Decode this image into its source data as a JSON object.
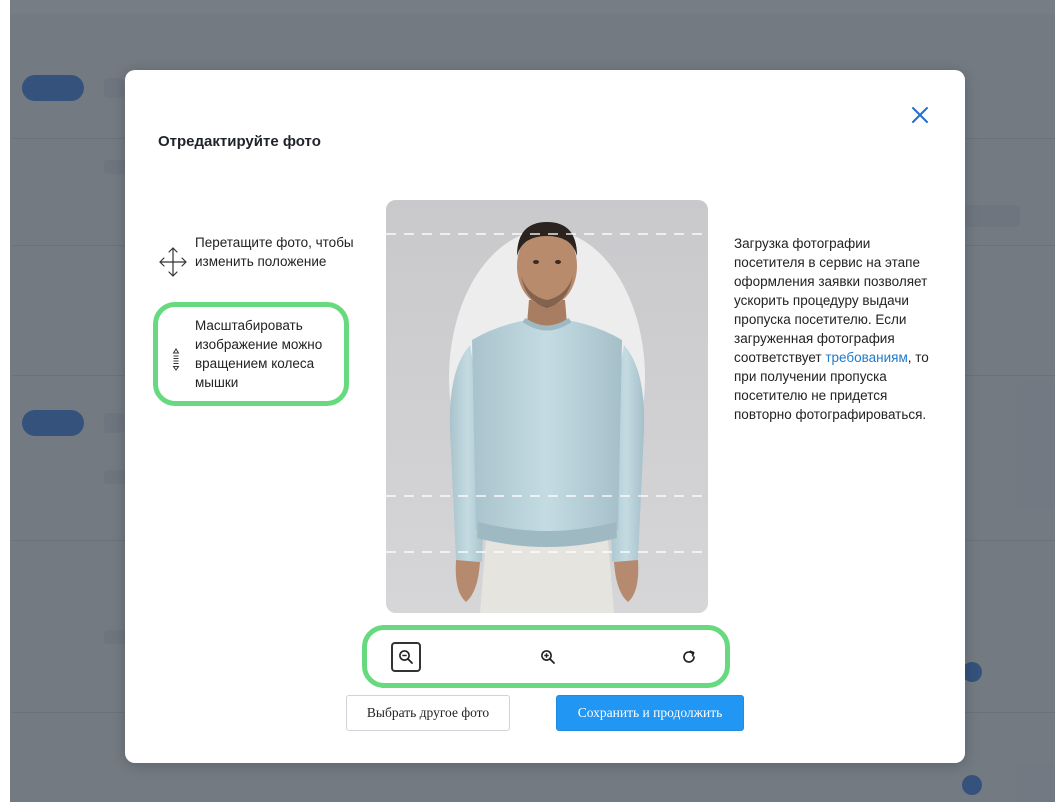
{
  "modal": {
    "title": "Отредактируйте фото",
    "close_icon": "close-icon"
  },
  "hints": {
    "drag": "Перетащите фото, чтобы изменить положение",
    "drag_icon": "move-arrows-icon",
    "zoom": "Масштабировать изображение можно вращением колеса мышки",
    "zoom_icon": "mouse-wheel-icon"
  },
  "info": {
    "part1": "Загрузка фотографии посетителя в сервис на этапе оформления заявки позволяет ускорить процедуру выдачи пропуска посетителю. Если загруженная фотография соответствует ",
    "link": "требованиям",
    "part2": ", то при получении пропуска посетителю не придется повторно фотографироваться."
  },
  "toolbar": {
    "zoom_out_icon": "zoom-out-icon",
    "zoom_in_icon": "zoom-in-icon",
    "rotate_icon": "rotate-icon"
  },
  "buttons": {
    "choose_other": "Выбрать другое фото",
    "save_continue": "Сохранить и продолжить"
  },
  "colors": {
    "primary": "#2196f3",
    "link": "#1f7ac9",
    "highlight": "#67da7f",
    "overlay": "#373f4b"
  }
}
